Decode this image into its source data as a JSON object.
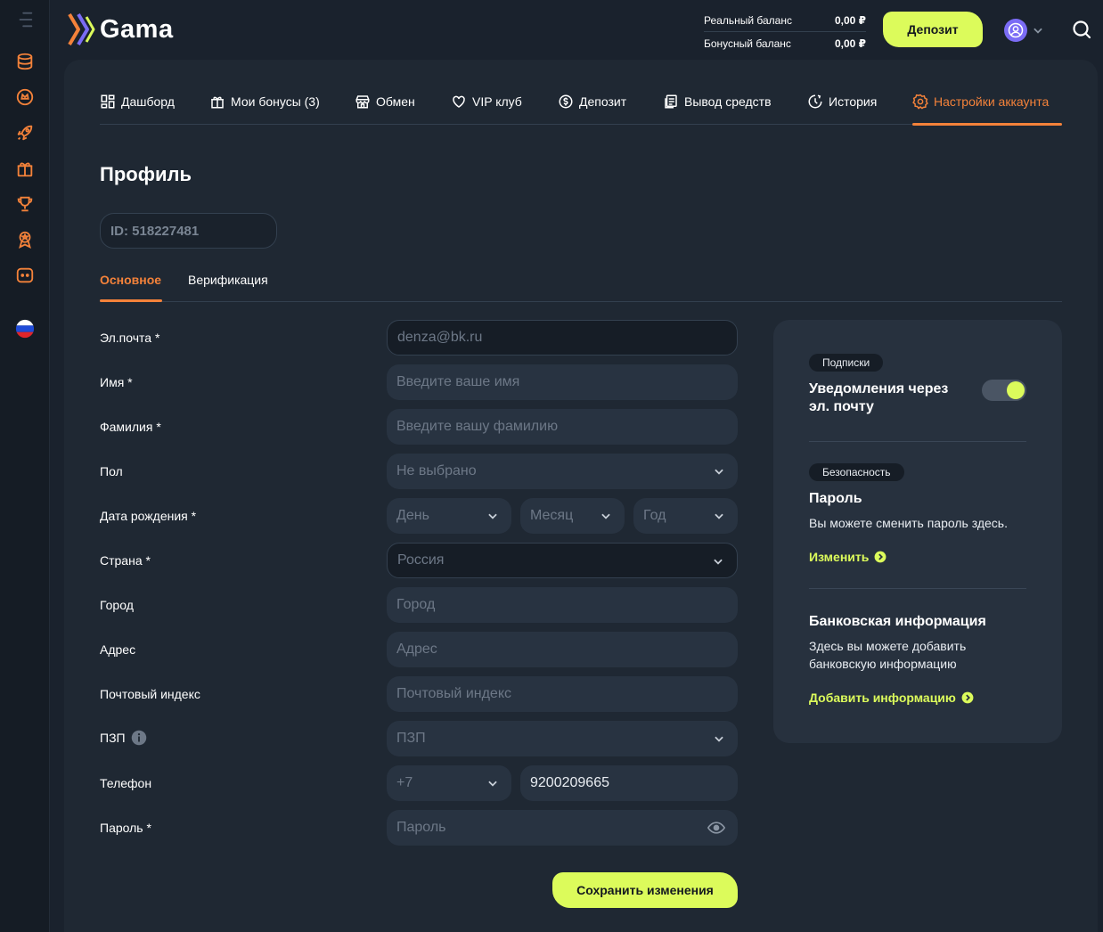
{
  "brand": {
    "name": "Gama",
    "accent": "#dcfb5b",
    "active": "#f4823a"
  },
  "header": {
    "balances": [
      {
        "label": "Реальный баланс",
        "value": "0,00 ₽"
      },
      {
        "label": "Бонусный баланс",
        "value": "0,00 ₽"
      }
    ],
    "deposit_label": "Депозит"
  },
  "sidebar": {
    "icons": [
      "menu-icon",
      "database-icon",
      "crown-coin-icon",
      "rocket-icon",
      "gift-icon",
      "trophy-icon",
      "medal-icon",
      "chat-icon",
      "russian-flag-icon"
    ]
  },
  "nav": {
    "tabs": [
      {
        "label": "Дашборд",
        "icon": "dashboard-icon"
      },
      {
        "label": "Мои бонусы (3)",
        "icon": "gift-icon"
      },
      {
        "label": "Обмен",
        "icon": "shop-icon"
      },
      {
        "label": "VIP клуб",
        "icon": "heart-icon"
      },
      {
        "label": "Депозит",
        "icon": "coin-icon"
      },
      {
        "label": "Вывод средств",
        "icon": "withdraw-icon"
      },
      {
        "label": "История",
        "icon": "history-icon"
      },
      {
        "label": "Настройки аккаунта",
        "icon": "gear-icon",
        "active": true
      }
    ]
  },
  "profile": {
    "title": "Профиль",
    "id_text": "ID: 518227481",
    "subtabs": [
      "Основное",
      "Верификация"
    ],
    "fields": {
      "email": {
        "label": "Эл.почта *",
        "value": "denza@bk.ru"
      },
      "first_name": {
        "label": "Имя *",
        "placeholder": "Введите ваше имя"
      },
      "last_name": {
        "label": "Фамилия *",
        "placeholder": "Введите вашу фамилию"
      },
      "gender": {
        "label": "Пол",
        "value": "Не выбрано"
      },
      "birth": {
        "label": "Дата рождения *",
        "day": "День",
        "month": "Месяц",
        "year": "Год"
      },
      "country": {
        "label": "Страна *",
        "value": "Россия"
      },
      "city": {
        "label": "Город",
        "placeholder": "Город"
      },
      "address": {
        "label": "Адрес",
        "placeholder": "Адрес"
      },
      "zip": {
        "label": "Почтовый индекс",
        "placeholder": "Почтовый индекс"
      },
      "pzp": {
        "label": "ПЗП",
        "value": "ПЗП"
      },
      "phone": {
        "label": "Телефон",
        "code": "+7",
        "number": "9200209665"
      },
      "password": {
        "label": "Пароль *",
        "placeholder": "Пароль"
      }
    },
    "save_label": "Сохранить изменения"
  },
  "side": {
    "subscriptions_chip": "Подписки",
    "notifications_title": "Уведомления через эл. почту",
    "notifications_enabled": true,
    "security_chip": "Безопасность",
    "password_title": "Пароль",
    "password_text": "Вы можете сменить пароль здесь.",
    "password_link": "Изменить",
    "bank_title": "Банковская информация",
    "bank_text": "Здесь вы можете добавить банковскую информацию",
    "bank_link": "Добавить информацию"
  }
}
